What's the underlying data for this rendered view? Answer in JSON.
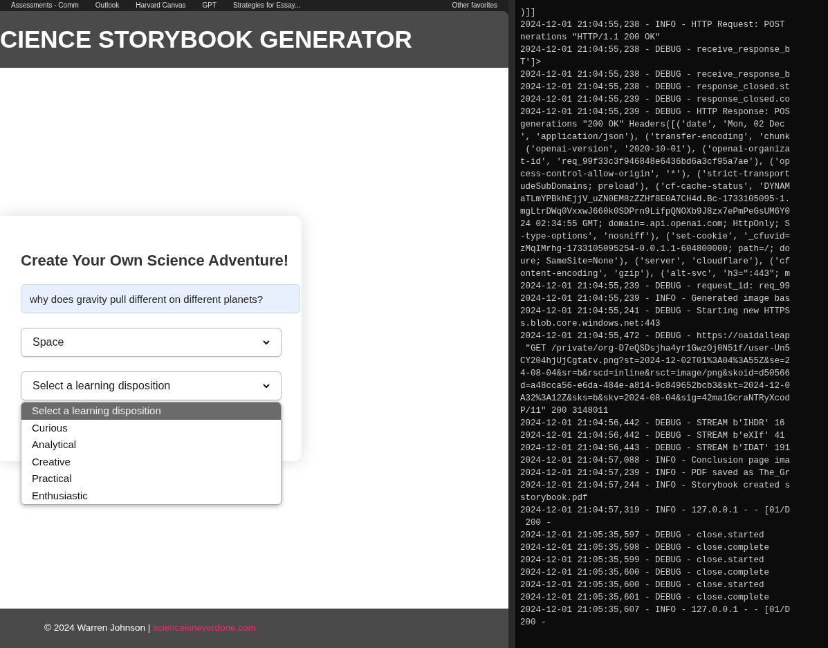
{
  "bookmarks": [
    {
      "label": "Assessments - Comm"
    },
    {
      "label": "Outlook"
    },
    {
      "label": "Harvard Canvas"
    },
    {
      "label": "GPT"
    },
    {
      "label": "Strategies for Essay..."
    }
  ],
  "other_favorites": "Other favorites",
  "header": {
    "title": "CIENCE STORYBOOK GENERATOR"
  },
  "form": {
    "heading": "Create Your Own Science Adventure!",
    "question": {
      "value": "why does gravity pull different on different planets?"
    },
    "selects": [
      {
        "value": "Space"
      },
      {
        "value": "Select a learning disposition"
      }
    ],
    "dropdown_options": [
      {
        "label": "Select a learning disposition",
        "selected": true
      },
      {
        "label": "Curious",
        "selected": false
      },
      {
        "label": "Analytical",
        "selected": false
      },
      {
        "label": "Creative",
        "selected": false
      },
      {
        "label": "Practical",
        "selected": false
      },
      {
        "label": "Enthusiastic",
        "selected": false
      }
    ]
  },
  "footer": {
    "text": "© 2024 Warren Johnson |",
    "link": "scienceisneverdone.com"
  },
  "terminal": {
    "lines": [
      ")]]",
      "2024-12-01 21:04:55,238 - INFO - HTTP Request: POST",
      "nerations \"HTTP/1.1 200 OK\"",
      "2024-12-01 21:04:55,238 - DEBUG - receive_response_b",
      "T']>",
      "2024-12-01 21:04:55,238 - DEBUG - receive_response_b",
      "2024-12-01 21:04:55,238 - DEBUG - response_closed.st",
      "2024-12-01 21:04:55,239 - DEBUG - response_closed.co",
      "2024-12-01 21:04:55,239 - DEBUG - HTTP Response: POS",
      "generations \"200 OK\" Headers([('date', 'Mon, 02 Dec",
      "', 'application/json'), ('transfer-encoding', 'chunk",
      " ('openai-version', '2020-10-01'), ('openai-organiza",
      "t-id', 'req_99f33c3f946848e6436bd6a3cf95a7ae'), ('op",
      "cess-control-allow-origin', '*'), ('strict-transport",
      "udeSubDomains; preload'), ('cf-cache-status', 'DYNAM",
      "aTLmYPBkhEjjV_uZN0EM8zZZHf8E0A7CH4d.Bc-1733105095-1.",
      "mgLtrDWq0VxxwJ660k0SDPrn9LifpQNOXb9J8zx7ePmPeGsUM6Y0",
      "24 02:34:55 GMT; domain=.api.openai.com; HttpOnly; S",
      "-type-options', 'nosniff'), ('set-cookie', '_cfuvid=",
      "zMqIMrhg-1733105095254-0.0.1.1-604800000; path=/; do",
      "ure; SameSite=None'), ('server', 'cloudflare'), ('cf",
      "ontent-encoding', 'gzip'), ('alt-svc', 'h3=\":443\"; m",
      "2024-12-01 21:04:55,239 - DEBUG - request_id: req_99",
      "2024-12-01 21:04:55,239 - INFO - Generated image bas",
      "2024-12-01 21:04:55,241 - DEBUG - Starting new HTTPS",
      "s.blob.core.windows.net:443",
      "2024-12-01 21:04:55,472 - DEBUG - https://oaidalleap",
      " \"GET /private/org-D7eQSDsjha4yr1GwzOj0N51f/user-Un5",
      "CY204hjUjCgtatv.png?st=2024-12-02T01%3A04%3A55Z&se=2",
      "4-08-04&sr=b&rscd=inline&rsct=image/png&skoid=d50566",
      "d=a48cca56-e6da-484e-a814-9c849652bcb3&skt=2024-12-0",
      "A32%3A12Z&sks=b&skv=2024-08-04&sig=42ma1GcraNTRyXcod",
      "P/11\" 200 3148011",
      "2024-12-01 21:04:56,442 - DEBUG - STREAM b'IHDR' 16",
      "2024-12-01 21:04:56,442 - DEBUG - STREAM b'eXIf' 41",
      "2024-12-01 21:04:56,443 - DEBUG - STREAM b'IDAT' 191",
      "2024-12-01 21:04:57,088 - INFO - Conclusion page ima",
      "2024-12-01 21:04:57,239 - INFO - PDF saved as The_Gr",
      "2024-12-01 21:04:57,244 - INFO - Storybook created s",
      "storybook.pdf",
      "2024-12-01 21:04:57,319 - INFO - 127.0.0.1 - - [01/D",
      " 200 -",
      "2024-12-01 21:05:35,597 - DEBUG - close.started",
      "2024-12-01 21:05:35,598 - DEBUG - close.complete",
      "2024-12-01 21:05:35,599 - DEBUG - close.started",
      "2024-12-01 21:05:35,600 - DEBUG - close.complete",
      "2024-12-01 21:05:35,600 - DEBUG - close.started",
      "2024-12-01 21:05:35,601 - DEBUG - close.complete",
      "2024-12-01 21:05:35,607 - INFO - 127.0.0.1 - - [01/D",
      "200 -"
    ]
  }
}
